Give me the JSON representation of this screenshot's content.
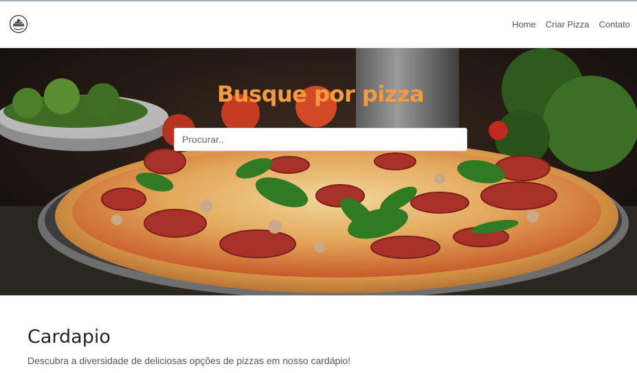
{
  "navbar": {
    "logo_icon": "pizza-logo-icon",
    "links": [
      "Home",
      "Criar Pizza",
      "Contato"
    ]
  },
  "hero": {
    "title": "Busque por pizza",
    "search_placeholder": "Procurar..",
    "search_value": "",
    "title_color": "#f59a3e"
  },
  "menu": {
    "title": "Cardapio",
    "description": "Descubra a diversidade de deliciosas opções de pizzas em nosso cardápio!"
  }
}
